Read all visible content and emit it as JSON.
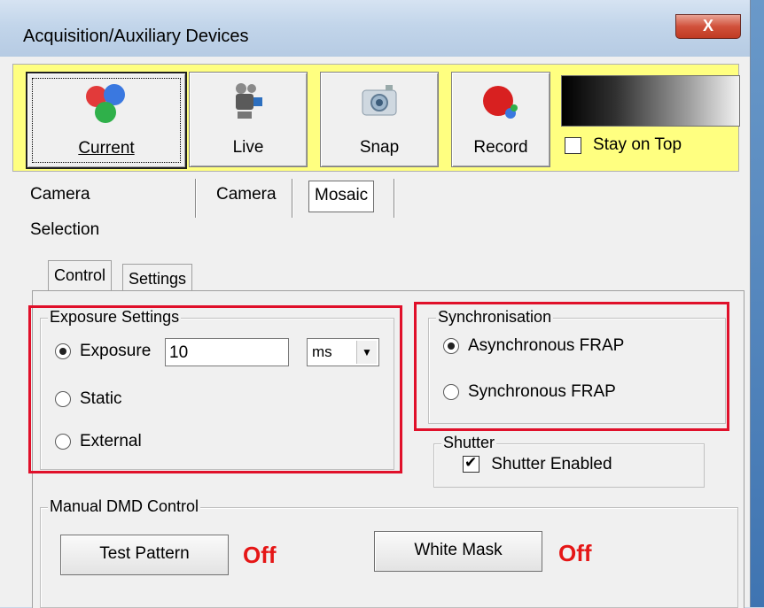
{
  "window": {
    "title": "Acquisition/Auxiliary Devices",
    "close_label": "X"
  },
  "toolbar": {
    "buttons": [
      {
        "label": "Current",
        "icon": "rgb-balls-icon"
      },
      {
        "label": "Live",
        "icon": "video-camera-icon"
      },
      {
        "label": "Snap",
        "icon": "photo-camera-icon"
      },
      {
        "label": "Record",
        "icon": "record-icon"
      }
    ],
    "stay_on_top": {
      "label": "Stay on Top",
      "checked": false
    }
  },
  "main_tabs": [
    "Camera Selection",
    "Camera",
    "Mosaic"
  ],
  "inner_tabs": [
    "Control",
    "Settings"
  ],
  "exposure_settings": {
    "title": "Exposure Settings",
    "exposure_label": "Exposure",
    "exposure_value": "10",
    "unit": "ms",
    "static_label": "Static",
    "external_label": "External",
    "selected": "Exposure"
  },
  "synchronisation": {
    "title": "Synchronisation",
    "async_label": "Asynchronous FRAP",
    "sync_label": "Synchronous FRAP",
    "selected": "Asynchronous FRAP"
  },
  "shutter": {
    "title": "Shutter",
    "label": "Shutter Enabled",
    "checked": true
  },
  "dmd": {
    "title": "Manual DMD Control",
    "test_pattern_label": "Test Pattern",
    "test_pattern_state": "Off",
    "white_mask_label": "White Mask",
    "white_mask_state": "Off"
  },
  "colors": {
    "highlight_red": "#e0102a",
    "off_red": "#e51616",
    "toolbar_yellow": "#ffff80"
  }
}
